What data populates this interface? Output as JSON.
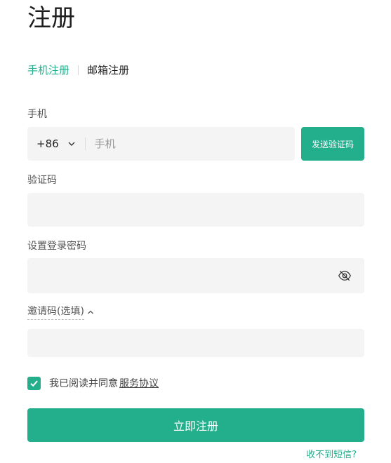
{
  "page": {
    "title": "注册"
  },
  "tabs": [
    {
      "label": "手机注册",
      "active": true
    },
    {
      "label": "邮箱注册",
      "active": false
    }
  ],
  "phone": {
    "label": "手机",
    "country_code": "+86",
    "placeholder": "手机",
    "send_code_label": "发送验证码"
  },
  "verify_code": {
    "label": "验证码",
    "value": ""
  },
  "password": {
    "label": "设置登录密码",
    "value": "",
    "icon": "eye-slash-icon"
  },
  "invite": {
    "label": "邀请码(选填)",
    "value": "",
    "icon": "chevron-up-icon"
  },
  "agreement": {
    "checked": true,
    "text": "我已阅读并同意",
    "link": "服务协议"
  },
  "submit": {
    "label": "立即注册"
  },
  "no_sms": {
    "label": "收不到短信?"
  },
  "colors": {
    "accent": "#23ae8c",
    "field_bg": "#f4f4f4"
  }
}
